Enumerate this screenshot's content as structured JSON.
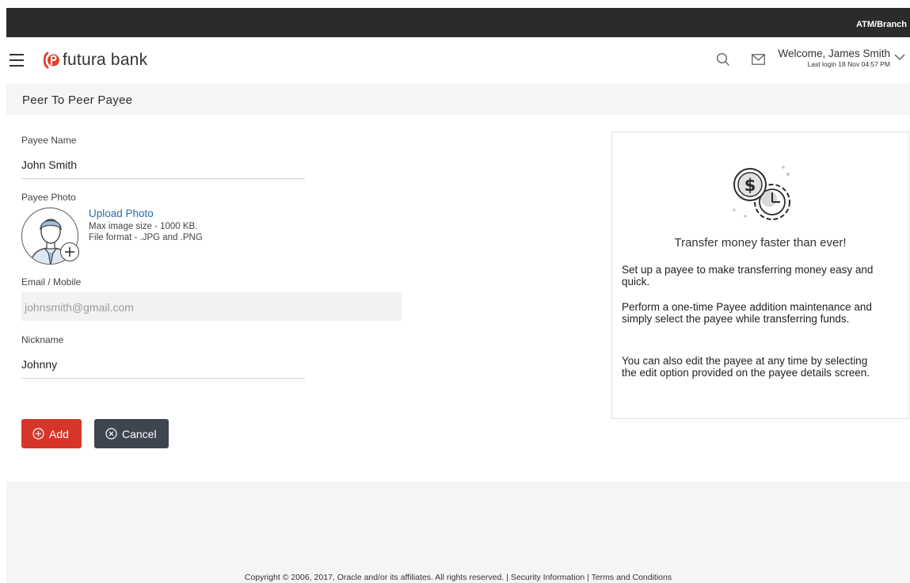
{
  "topbar": {
    "link": "ATM/Branch"
  },
  "header": {
    "brand": "futura bank",
    "welcome": "Welcome, James Smith",
    "last_login": "Last login 18 Nov 04:57 PM"
  },
  "page": {
    "title": "Peer To Peer Payee"
  },
  "form": {
    "payee_name": {
      "label": "Payee Name",
      "value": "John Smith"
    },
    "payee_photo": {
      "label": "Payee Photo",
      "upload_link": "Upload Photo",
      "max_size": "Max image size - 1000 KB.",
      "formats": "File format - .JPG and .PNG"
    },
    "email": {
      "label": "Email / Mobile",
      "placeholder": "johnsmith@gmail.com"
    },
    "nickname": {
      "label": "Nickname",
      "value": "Johnny"
    },
    "buttons": {
      "add": "Add",
      "cancel": "Cancel"
    }
  },
  "info_card": {
    "title": "Transfer money faster than ever!",
    "paragraphs": [
      "Set up a payee to make transferring money easy and quick.",
      "Perform a one-time Payee addition maintenance and simply select the payee while transferring funds.",
      "You can also edit the payee at any time by selecting the edit option provided on the payee details screen."
    ]
  },
  "footer": {
    "copyright": "Copyright © 2006, 2017, Oracle and/or its affiliates. All rights reserved.",
    "separator": " | ",
    "security": "Security Information",
    "terms": "Terms and Conditions"
  },
  "colors": {
    "brand_red": "#d8352a",
    "cancel_gray": "#3f4550",
    "link_blue": "#2d6ca2",
    "topbar": "#2b2b2b"
  },
  "icons": [
    "menu-icon",
    "logo-icon",
    "search-icon",
    "mail-icon",
    "chevron-down-icon",
    "avatar-icon",
    "plus-icon",
    "add-circle-icon",
    "cancel-circle-icon",
    "money-clock-icon"
  ]
}
